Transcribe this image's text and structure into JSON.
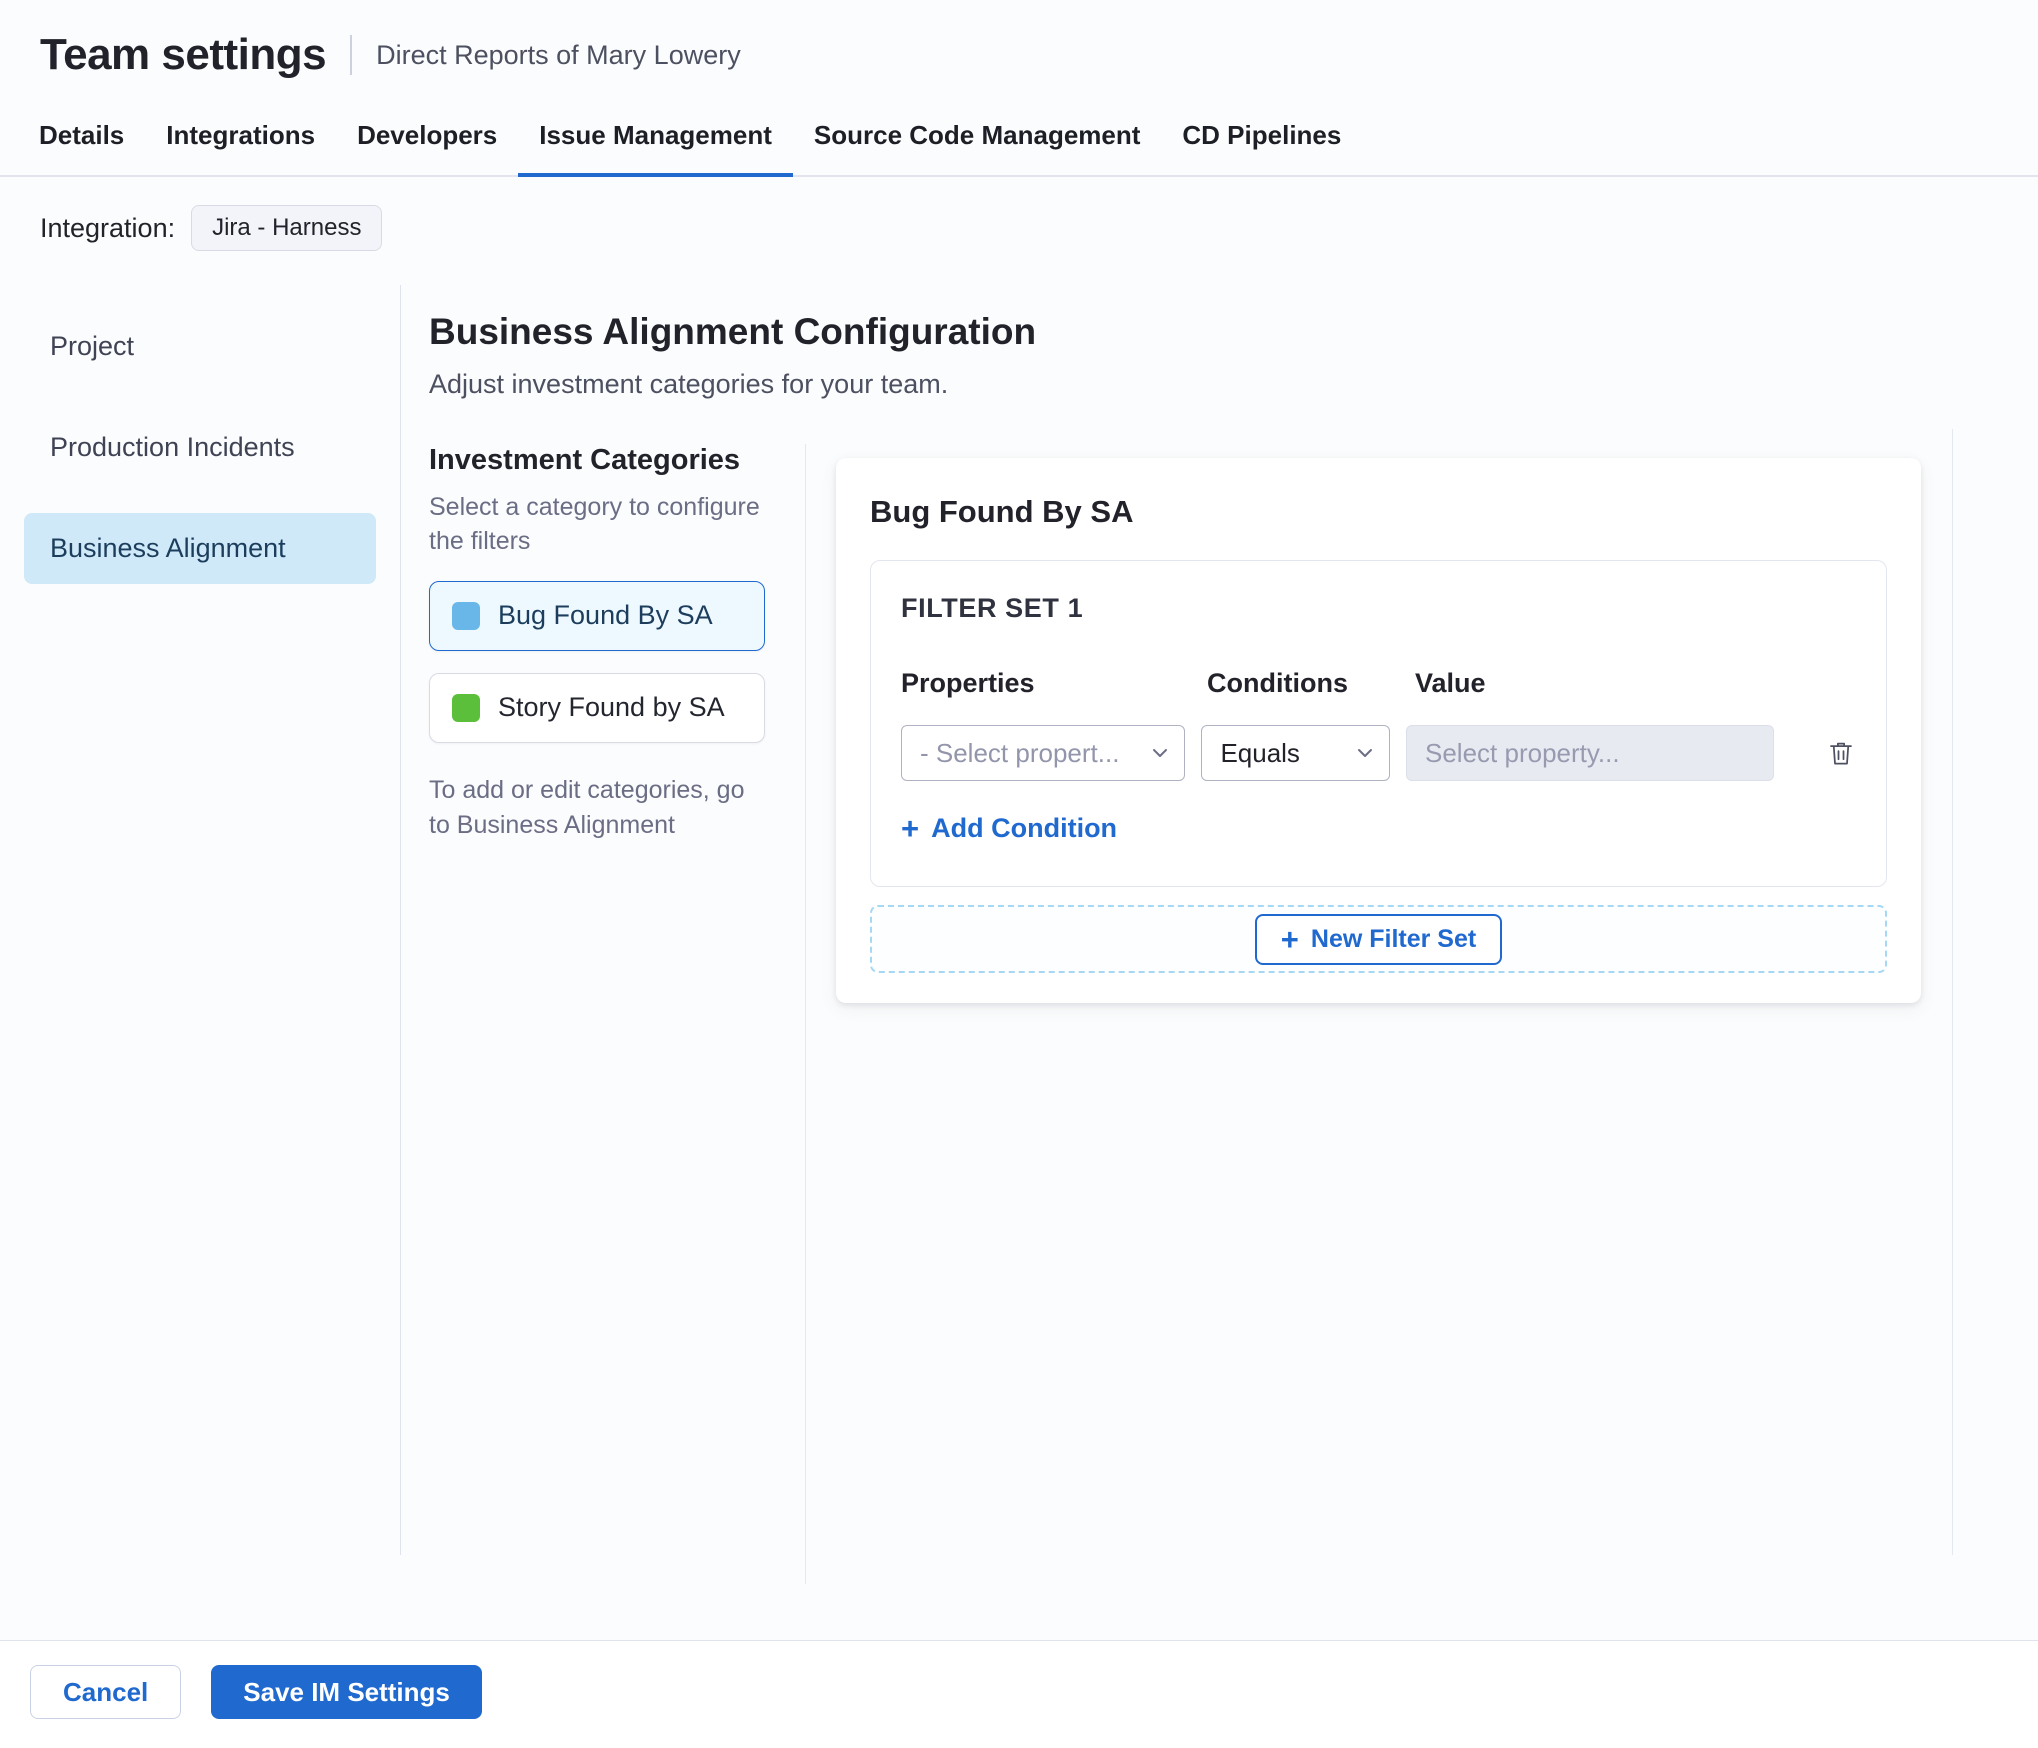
{
  "header": {
    "title": "Team settings",
    "subtitle": "Direct Reports of Mary Lowery"
  },
  "tabs": [
    {
      "label": "Details"
    },
    {
      "label": "Integrations"
    },
    {
      "label": "Developers"
    },
    {
      "label": "Issue Management"
    },
    {
      "label": "Source Code Management"
    },
    {
      "label": "CD Pipelines"
    }
  ],
  "active_tab": "Issue Management",
  "integration": {
    "label": "Integration:",
    "chip": "Jira - Harness"
  },
  "sidebar": {
    "items": [
      {
        "label": "Project"
      },
      {
        "label": "Production Incidents"
      },
      {
        "label": "Business Alignment"
      }
    ],
    "selected": "Business Alignment"
  },
  "main": {
    "title": "Business Alignment Configuration",
    "subtitle": "Adjust investment categories for your team.",
    "categories": {
      "heading": "Investment Categories",
      "hint": "Select a category to configure the filters",
      "items": [
        {
          "label": "Bug Found By SA",
          "color": "#68b7e8"
        },
        {
          "label": "Story Found by SA",
          "color": "#5bbf3b"
        }
      ],
      "selected": "Bug Found By SA",
      "footnote": "To add or edit categories, go to Business Alignment"
    },
    "panel": {
      "title": "Bug Found By SA",
      "filter_set": {
        "title": "FILTER SET 1",
        "properties_label": "Properties",
        "conditions_label": "Conditions",
        "value_label": "Value",
        "property_placeholder": "- Select propert...",
        "condition_selected": "Equals",
        "value_placeholder": "Select property...",
        "add_condition": "Add Condition"
      },
      "new_filter_set": "New Filter Set"
    }
  },
  "footer": {
    "cancel": "Cancel",
    "save": "Save IM Settings"
  },
  "icons": {
    "plus": "+"
  },
  "colors": {
    "accent": "#2069cf",
    "nav_selected_bg": "#cfe9f9",
    "category_selected_bg": "#eef8ff",
    "input_disabled_bg": "#e8eaf1"
  }
}
